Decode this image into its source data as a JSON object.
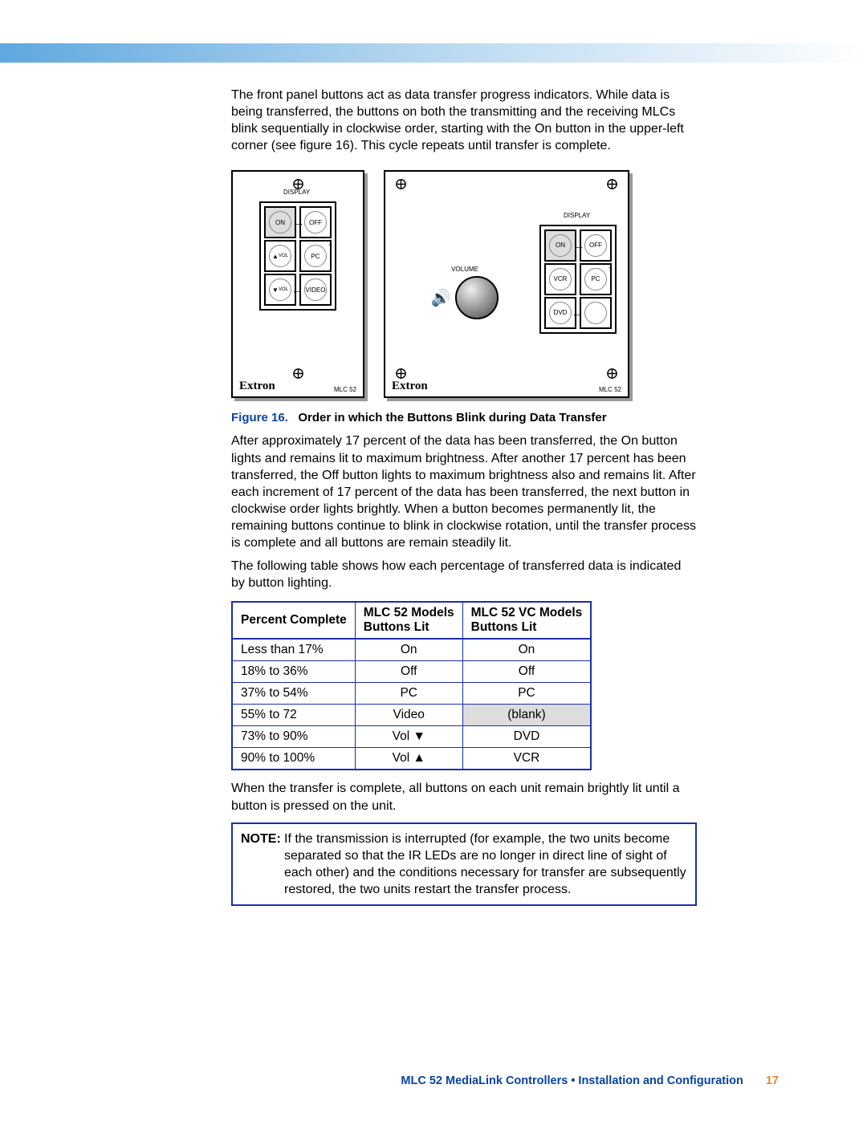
{
  "paragraphs": {
    "p1": "The front panel buttons act as data transfer progress indicators. While data is being transferred, the buttons on both the transmitting and the receiving MLCs blink sequentially in clockwise order, starting with the On button in the upper-left corner (see figure 16). This cycle repeats until transfer is complete.",
    "p2": "After approximately 17 percent of the data has been transferred, the On button lights and remains lit to maximum brightness. After another 17 percent has been transferred, the Off button lights to maximum brightness also and remains lit. After each increment of 17 percent of the data has been transferred, the next button in clockwise order lights brightly. When a button becomes permanently lit, the remaining buttons continue to blink in clockwise rotation, until the transfer process is complete and all buttons are remain steadily lit.",
    "p3": "The following table shows how each percentage of transferred data is indicated by button lighting.",
    "p4": "When the transfer is complete, all buttons on each unit remain brightly lit until a button is pressed on the unit."
  },
  "figure": {
    "lead": "Figure 16.",
    "title": "Order in which the Buttons Blink during Data Transfer",
    "brand": "Extron",
    "model": "MLC 52",
    "display_label": "DISPLAY",
    "volume_label": "VOLUME",
    "btn_on": "ON",
    "btn_off": "OFF",
    "btn_pc": "PC",
    "btn_video": "VIDEO",
    "btn_vol_up": "VOL",
    "btn_vol_down": "VOL",
    "btn_vcr": "VCR",
    "btn_dvd": "DVD"
  },
  "table": {
    "headers": {
      "c1": "Percent Complete",
      "c2a": "MLC 52 Models",
      "c2b": "Buttons Lit",
      "c3a": "MLC 52 VC Models",
      "c3b": "Buttons Lit"
    },
    "rows": [
      {
        "pc": "Less than 17%",
        "m52": "On",
        "vc": "On"
      },
      {
        "pc": "18% to 36%",
        "m52": "Off",
        "vc": "Off"
      },
      {
        "pc": "37% to 54%",
        "m52": "PC",
        "vc": "PC"
      },
      {
        "pc": "55% to 72",
        "m52": "Video",
        "vc": "(blank)",
        "blank": true
      },
      {
        "pc": "73% to 90%",
        "m52": "Vol ▼",
        "vc": "DVD"
      },
      {
        "pc": "90% to 100%",
        "m52": "Vol ▲",
        "vc": "VCR"
      }
    ]
  },
  "note": {
    "lead": "NOTE:",
    "text": "If the transmission is interrupted (for example, the two units become separated so that the IR LEDs are no longer in direct line of sight of each other) and the conditions necessary for transfer are subsequently restored, the two units restart the transfer process."
  },
  "footer": {
    "title": "MLC 52 MediaLink Controllers • Installation and Configuration",
    "page": "17"
  }
}
